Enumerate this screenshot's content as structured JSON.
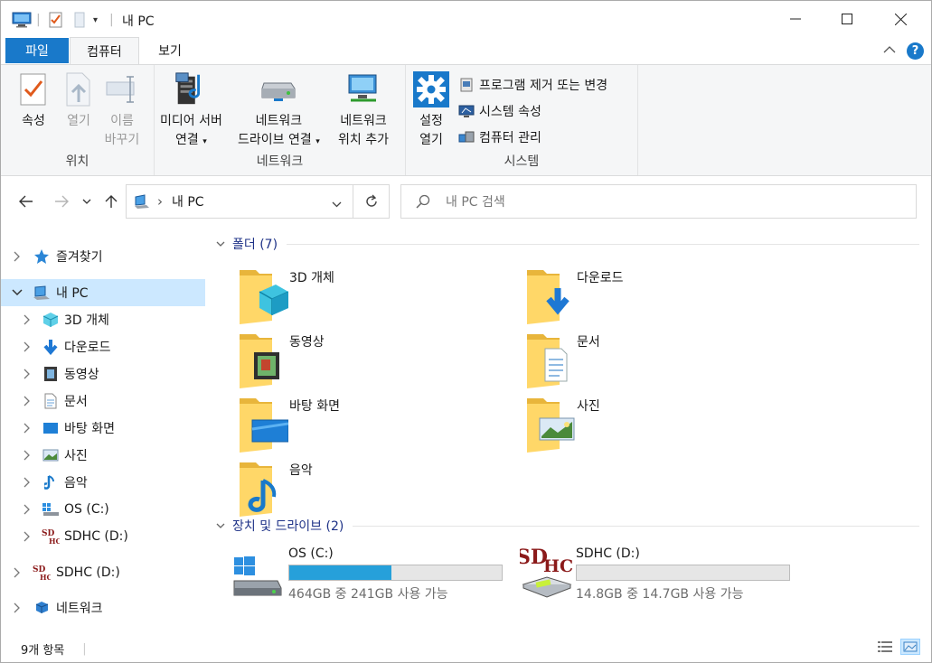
{
  "window": {
    "title": "내 PC",
    "minimize": "─",
    "maximize": "☐",
    "close": "✕"
  },
  "ribbon_tabs": {
    "file": "파일",
    "computer": "컴퓨터",
    "view": "보기"
  },
  "ribbon": {
    "location": {
      "label": "위치",
      "properties": "속성",
      "open": "열기",
      "rename_line1": "이름",
      "rename_line2": "바꾸기"
    },
    "network": {
      "label": "네트워크",
      "media_line1": "미디어 서버",
      "media_line2": "연결",
      "mapdrive_line1": "네트워크",
      "mapdrive_line2": "드라이브 연결",
      "addloc_line1": "네트워크",
      "addloc_line2": "위치 추가"
    },
    "system": {
      "label": "시스템",
      "settings_line1": "설정",
      "settings_line2": "열기",
      "uninstall": "프로그램 제거 또는 변경",
      "sysprops": "시스템 속성",
      "manage": "컴퓨터 관리"
    }
  },
  "address": {
    "path": "내 PC",
    "separator": "›"
  },
  "search": {
    "placeholder": "내 PC 검색"
  },
  "nav": {
    "quick_access": "즐겨찾기",
    "this_pc": "내 PC",
    "children": [
      "3D 개체",
      "다운로드",
      "동영상",
      "문서",
      "바탕 화면",
      "사진",
      "음악",
      "OS (C:)",
      "SDHC (D:)"
    ],
    "sdhc": "SDHC (D:)",
    "network": "네트워크"
  },
  "content": {
    "folders_header": "폴더 (7)",
    "folders": [
      "3D 개체",
      "다운로드",
      "동영상",
      "문서",
      "바탕 화면",
      "사진",
      "음악"
    ],
    "drives_header": "장치 및 드라이브 (2)",
    "drives": [
      {
        "name": "OS (C:)",
        "free": "464GB 중 241GB 사용 가능",
        "used_fraction": 0.48
      },
      {
        "name": "SDHC (D:)",
        "free": "14.8GB 중 14.7GB 사용 가능",
        "used_fraction": 0.0
      }
    ]
  },
  "status": {
    "count": "9개 항목"
  },
  "colors": {
    "accent": "#1979ca",
    "selected": "#cce8ff",
    "bar": "#26a0da",
    "section": "#1e3287"
  },
  "sdhc_logo": "SDHC"
}
